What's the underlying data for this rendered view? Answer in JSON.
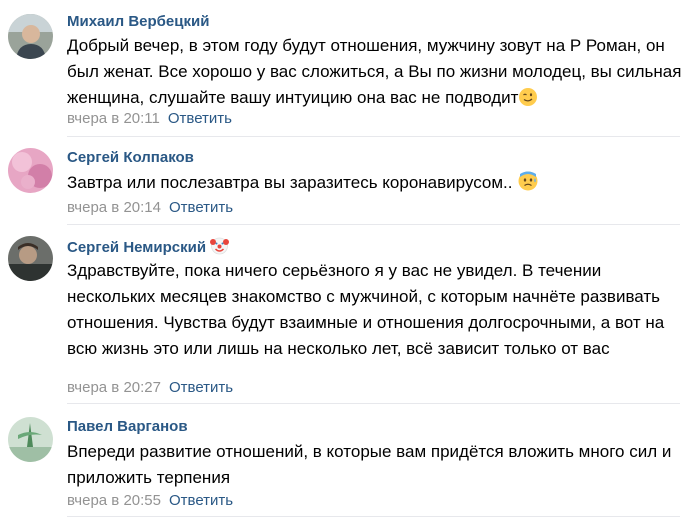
{
  "comments": [
    {
      "author": "Михаил Вербецкий",
      "text": "Добрый вечер, в этом году будут отношения, мужчину зовут на Р Роман, он был женат. Все хорошо у вас сложиться, а Вы по жизни молодец, вы сильная женщина, слушайте вашу интуицию она вас не подводит",
      "text_emoji": "wink-emoji",
      "date": "вчера в 20:11",
      "reply_label": "Ответить"
    },
    {
      "author": "Сергей Колпаков",
      "text": "Завтра или послезавтра вы заразитесь коронавирусом..",
      "text_emoji": "anxious-sweat-emoji",
      "date": "вчера в 20:14",
      "reply_label": "Ответить"
    },
    {
      "author": "Сергей Немирский",
      "author_emoji": "clown-emoji",
      "text": "Здравствуйте, пока ничего серьёзного я у вас не увидел. В течении нескольких месяцев знакомство с мужчиной, с которым начнёте развивать отношения. Чувства будут взаимные и отношения долгосрочными, а вот на всю жизнь это или лишь на несколько лет, всё зависит только от вас",
      "date": "вчера в 20:27",
      "reply_label": "Ответить"
    },
    {
      "author": "Павел Варганов",
      "text": "Впереди развитие отношений, в которые вам придётся вложить много сил и приложить терпения",
      "date": "вчера в 20:55",
      "reply_label": "Ответить"
    }
  ],
  "colors": {
    "link": "#2a5885",
    "date": "#939393",
    "divider": "#e7e8ec"
  }
}
